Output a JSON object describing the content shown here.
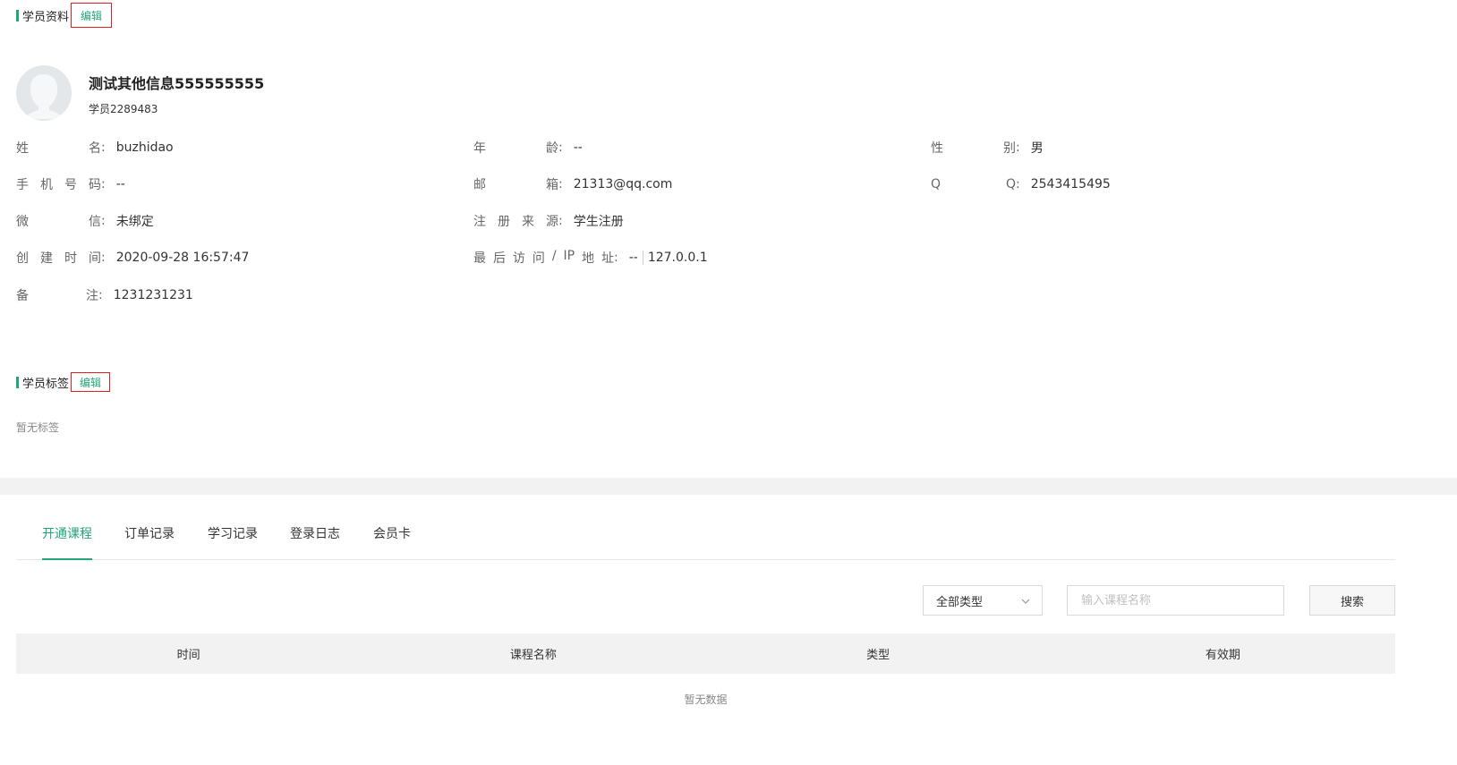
{
  "student_info": {
    "title": "学员资料",
    "edit_label": "编辑",
    "name_display": "测试其他信息555555555",
    "student_id": "学员2289483",
    "fields": {
      "name": {
        "label": "姓名",
        "value": "buzhidao"
      },
      "age": {
        "label": "年龄",
        "value": "--"
      },
      "gender": {
        "label": "性别",
        "value": "男"
      },
      "phone": {
        "label": "手机号码",
        "value": "--"
      },
      "email": {
        "label": "邮箱",
        "value": "21313@qq.com"
      },
      "qq": {
        "label": "QQ",
        "value": "2543415495"
      },
      "wechat": {
        "label": "微信",
        "value": "未绑定"
      },
      "source": {
        "label": "注册来源",
        "value": "学生注册"
      },
      "created": {
        "label": "创建时间",
        "value": "2020-09-28 16:57:47"
      },
      "last_visit": {
        "label": "最后访问/IP地址",
        "value": "--",
        "ip": "127.0.0.1"
      },
      "remark": {
        "label": "备注",
        "value": "1231231231"
      }
    }
  },
  "student_tags": {
    "title": "学员标签",
    "edit_label": "编辑",
    "empty_text": "暂无标签"
  },
  "tabs": [
    {
      "label": "开通课程",
      "active": true
    },
    {
      "label": "订单记录",
      "active": false
    },
    {
      "label": "学习记录",
      "active": false
    },
    {
      "label": "登录日志",
      "active": false
    },
    {
      "label": "会员卡",
      "active": false
    }
  ],
  "filters": {
    "type_select": "全部类型",
    "search_placeholder": "输入课程名称",
    "search_button": "搜索"
  },
  "table": {
    "columns": [
      "时间",
      "课程名称",
      "类型",
      "有效期"
    ],
    "empty_text": "暂无数据"
  },
  "colors": {
    "accent": "#21a67a",
    "edit_border": "#e02020"
  }
}
